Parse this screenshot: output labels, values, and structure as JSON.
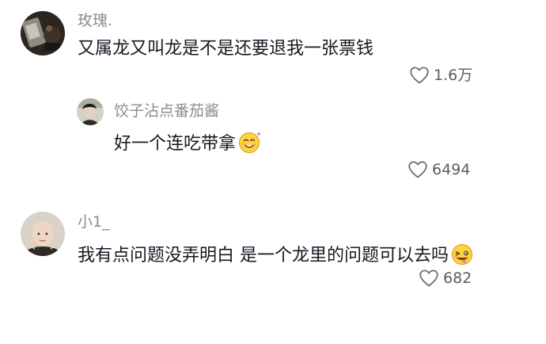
{
  "comments": [
    {
      "username": "玫瑰.",
      "content": "又属龙又叫龙是不是还要退我一张票钱",
      "likes": "1.6万",
      "like_icon": "heart-outline-icon"
    },
    {
      "username": "饺子沾点番茄酱",
      "content": "好一个连吃带拿",
      "likes": "6494",
      "like_icon": "heart-outline-icon",
      "emoji": "dizzy-smile-emoji"
    },
    {
      "username": "小1_",
      "content": "我有点问题没弄明白 是一个龙里的问题可以去吗",
      "likes": "682",
      "like_icon": "heart-outline-icon",
      "emoji": "winking-tongue-emoji"
    }
  ],
  "colors": {
    "username": "#8a8b91",
    "content": "#161823",
    "like_count": "#5b5d66",
    "heart_stroke": "#6b6d75",
    "emoji_face": "#ffd23f"
  }
}
